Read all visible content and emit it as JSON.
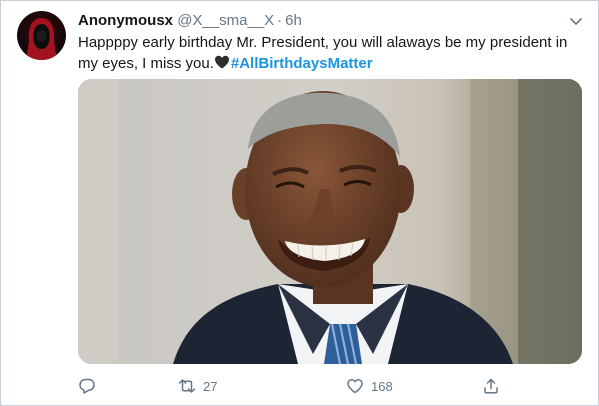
{
  "tweet": {
    "display_name": "Anonymousx",
    "handle": "@X__sma__X",
    "separator": "·",
    "time": "6h",
    "text_part": "Happppy early birthday Mr. President, you will alaways be my president in my eyes, I miss you.",
    "emoji": "black-heart",
    "hashtag": "#AllBirthdaysMatter",
    "media": {
      "image": "smiling-man-in-suit-photo"
    }
  },
  "actions": {
    "reply_count": "",
    "retweet_count": "27",
    "like_count": "168"
  },
  "colors": {
    "accent": "#1b95e0",
    "secondary_text": "#657786",
    "primary_text": "#14171a",
    "border": "#c9cfd4"
  },
  "icons": [
    "more-chevron-icon",
    "reply-icon",
    "retweet-icon",
    "like-icon",
    "share-icon"
  ]
}
